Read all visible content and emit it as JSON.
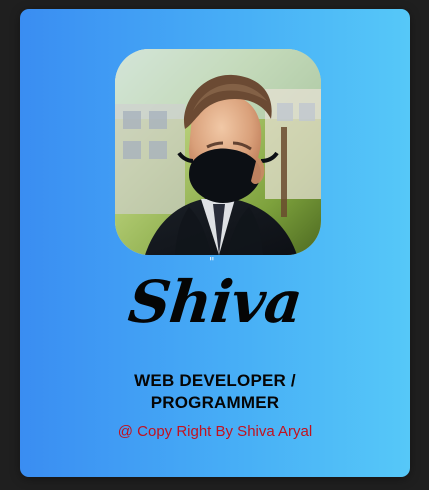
{
  "profile": {
    "quote_mark": "\"",
    "name": "Shiva",
    "role_line1": "WEB DEVELOPER /",
    "role_line2": "PROGRAMMER",
    "footer_text": "@ Copy Right By Shiva Aryal"
  },
  "colors": {
    "background": "#1f1f1f",
    "card_gradient_start": "#3a8df2",
    "card_gradient_end": "#56c8f8",
    "footer_text": "#c1121f",
    "name_text": "#050505"
  },
  "icons": {
    "avatar": "profile-photo"
  }
}
